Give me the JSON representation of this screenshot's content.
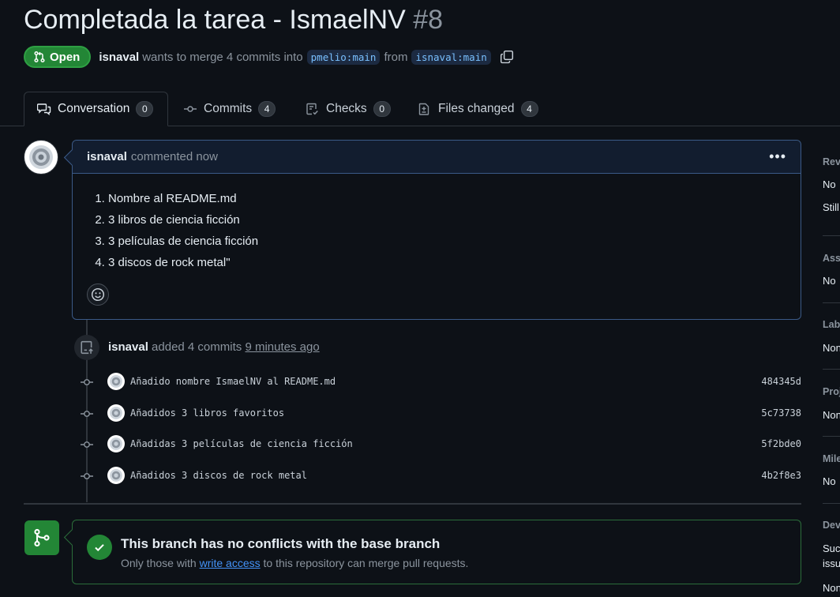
{
  "pr": {
    "title": "Completada la tarea - IsmaelNV",
    "number": "#8",
    "state": "Open",
    "author": "isnaval",
    "merge_text": "wants to merge 4 commits into",
    "base_branch": "pmelio:main",
    "from_text": "from",
    "head_branch": "isnaval:main"
  },
  "tabs": [
    {
      "label": "Conversation",
      "count": "0",
      "icon": "comment-discussion-icon"
    },
    {
      "label": "Commits",
      "count": "4",
      "icon": "git-commit-icon"
    },
    {
      "label": "Checks",
      "count": "0",
      "icon": "checklist-icon"
    },
    {
      "label": "Files changed",
      "count": "4",
      "icon": "file-diff-icon"
    }
  ],
  "comment": {
    "author": "isnaval",
    "action": "commented now",
    "items": [
      "Nombre al README.md",
      "3 libros de ciencia ficción",
      "3 películas de ciencia ficción",
      "3 discos de rock metal\""
    ]
  },
  "event": {
    "author": "isnaval",
    "action": "added 4 commits",
    "time": "9 minutes ago"
  },
  "commits": [
    {
      "message": "Añadido nombre IsmaelNV al README.md",
      "sha": "484345d"
    },
    {
      "message": "Añadidos 3 libros favoritos",
      "sha": "5c73738"
    },
    {
      "message": "Añadidas 3 películas de ciencia ficción",
      "sha": "5f2bde0"
    },
    {
      "message": "Añadidos 3 discos de rock metal",
      "sha": "4b2f8e3"
    }
  ],
  "merge": {
    "title": "This branch has no conflicts with the base branch",
    "sub_prefix": "Only those with",
    "sub_link": "write access",
    "sub_suffix": "to this repository can merge pull requests."
  },
  "sidebar": {
    "reviewers_h": "Rev",
    "reviewers_v1": "No",
    "reviewers_v2": "Still",
    "assignees_h": "Assi",
    "assignees_v": "No",
    "labels_h": "Lab",
    "labels_v": "Non",
    "projects_h": "Proj",
    "projects_v": "Non",
    "milestone_h": "Mile",
    "milestone_v": "No",
    "development_h": "Dev",
    "development_v1": "Suc",
    "development_v2": "issu",
    "development_v3": "Non"
  },
  "colors": {
    "background": "#0d1117",
    "open_green": "#238636",
    "link_blue": "#4493f8",
    "border": "#30363d"
  }
}
